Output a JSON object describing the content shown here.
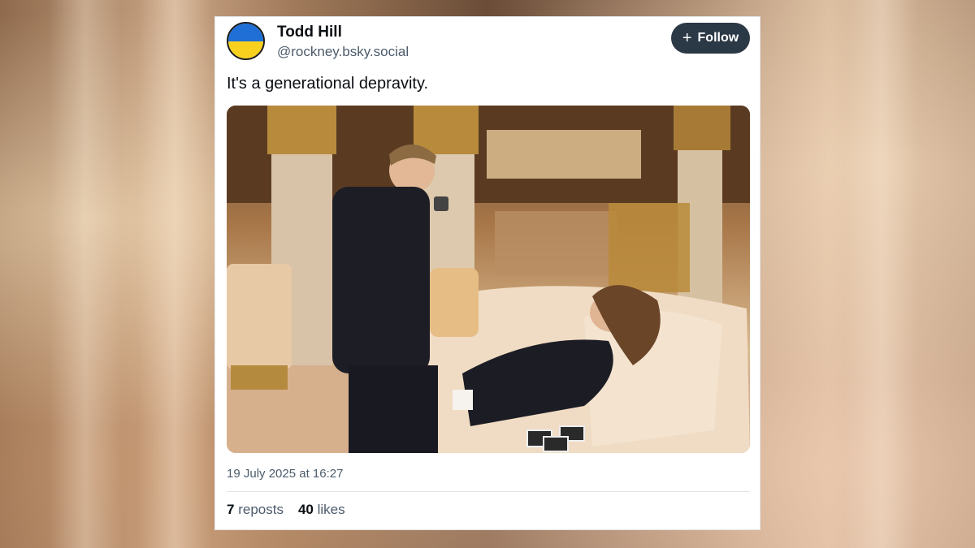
{
  "post": {
    "author_name": "Todd Hill",
    "author_handle": "@rockney.bsky.social",
    "follow_label": "Follow",
    "text": "It's a generational depravity.",
    "timestamp": "19 July 2025 at 16:27",
    "reposts_count": "7",
    "reposts_label": "reposts",
    "likes_count": "40",
    "likes_label": "likes"
  },
  "avatar": {
    "flag_top_color": "#1f6fd6",
    "flag_bottom_color": "#f7d11e"
  },
  "colors": {
    "follow_button": "#2b3846",
    "muted_text": "#4c5b6b"
  },
  "icons": {
    "follow": "plus-icon"
  }
}
